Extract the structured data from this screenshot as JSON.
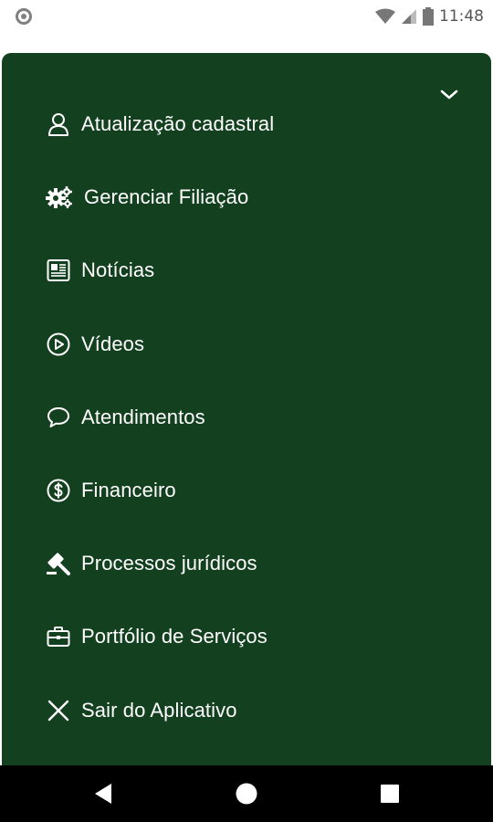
{
  "status_bar": {
    "time": "11:48"
  },
  "drawer": {
    "collapse_icon": "chevron-down-icon",
    "items": [
      {
        "label": "Atualização cadastral",
        "icon": "user-icon"
      },
      {
        "label": "Gerenciar Filiação",
        "icon": "gears-icon"
      },
      {
        "label": "Notícias",
        "icon": "newspaper-icon"
      },
      {
        "label": "Vídeos",
        "icon": "play-circle-icon"
      },
      {
        "label": "Atendimentos",
        "icon": "chat-bubble-icon"
      },
      {
        "label": "Financeiro",
        "icon": "dollar-circle-icon"
      },
      {
        "label": "Processos jurídicos",
        "icon": "gavel-icon"
      },
      {
        "label": "Portfólio de Serviços",
        "icon": "briefcase-icon"
      },
      {
        "label": "Sair do Aplicativo",
        "icon": "close-icon"
      }
    ]
  },
  "colors": {
    "drawer_bg": "#13401f",
    "text": "#ffffff"
  }
}
